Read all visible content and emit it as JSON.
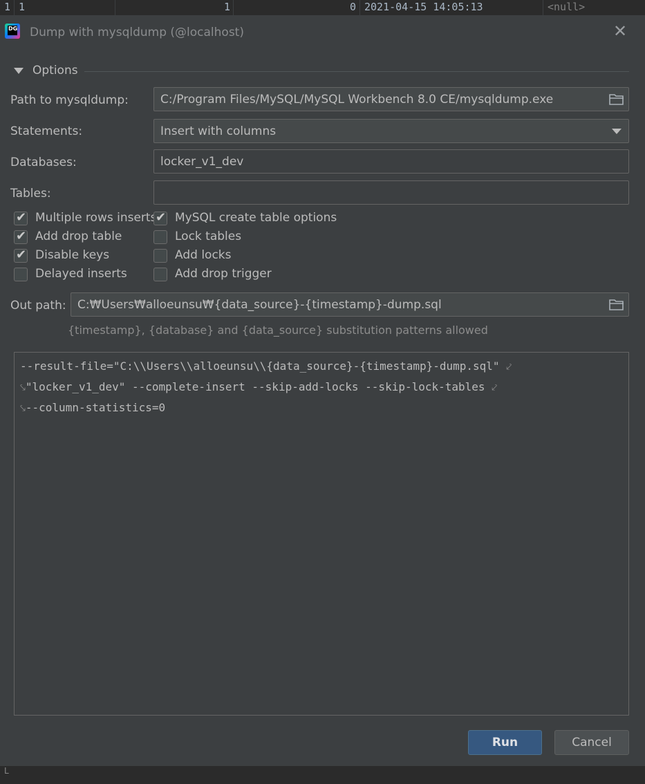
{
  "background_row": {
    "row_num": "1",
    "cells": [
      "1",
      "1",
      "0",
      "2021-04-15 14:05:13",
      "<null>"
    ]
  },
  "background_bottom_text": "ᒪ",
  "dialog": {
    "title": "Dump with mysqldump (@localhost)",
    "app_icon_text": "DG",
    "close_glyph": "✕"
  },
  "options": {
    "section_title": "Options",
    "path_label": "Path to mysqldump:",
    "path_value": "C:/Program Files/MySQL/MySQL Workbench 8.0 CE/mysqldump.exe",
    "statements_label": "Statements:",
    "statements_value": "Insert with columns",
    "databases_label": "Databases:",
    "databases_value": "locker_v1_dev",
    "tables_label": "Tables:",
    "tables_value": ""
  },
  "checkboxes_left": [
    {
      "label": "Multiple rows inserts",
      "checked": true
    },
    {
      "label": "Add drop table",
      "checked": true
    },
    {
      "label": "Disable keys",
      "checked": true
    },
    {
      "label": "Delayed inserts",
      "checked": false
    }
  ],
  "checkboxes_right": [
    {
      "label": "MySQL create table options",
      "checked": true
    },
    {
      "label": "Lock tables",
      "checked": false
    },
    {
      "label": "Add locks",
      "checked": false
    },
    {
      "label": "Add drop trigger",
      "checked": false
    }
  ],
  "out_path": {
    "label": "Out path:",
    "value": "C:₩Users₩alloeunsu₩{data_source}-{timestamp}-dump.sql",
    "hint": "{timestamp}, {database} and {data_source} substitution patterns allowed"
  },
  "command": {
    "lines": [
      {
        "prefix": "",
        "text": "--result-file=\"C:\\\\Users\\\\alloeunsu\\\\{data_source}-{timestamp}-dump.sql\" ",
        "suffix": "⤦"
      },
      {
        "prefix": "⤥",
        "text": "\"locker_v1_dev\" --complete-insert --skip-add-locks --skip-lock-tables ",
        "suffix": "⤦"
      },
      {
        "prefix": "⤥",
        "text": "--column-statistics=0",
        "suffix": ""
      }
    ]
  },
  "buttons": {
    "run": "Run",
    "cancel": "Cancel"
  },
  "colors": {
    "dialog_bg": "#3c3f41",
    "accent_button": "#365880"
  }
}
